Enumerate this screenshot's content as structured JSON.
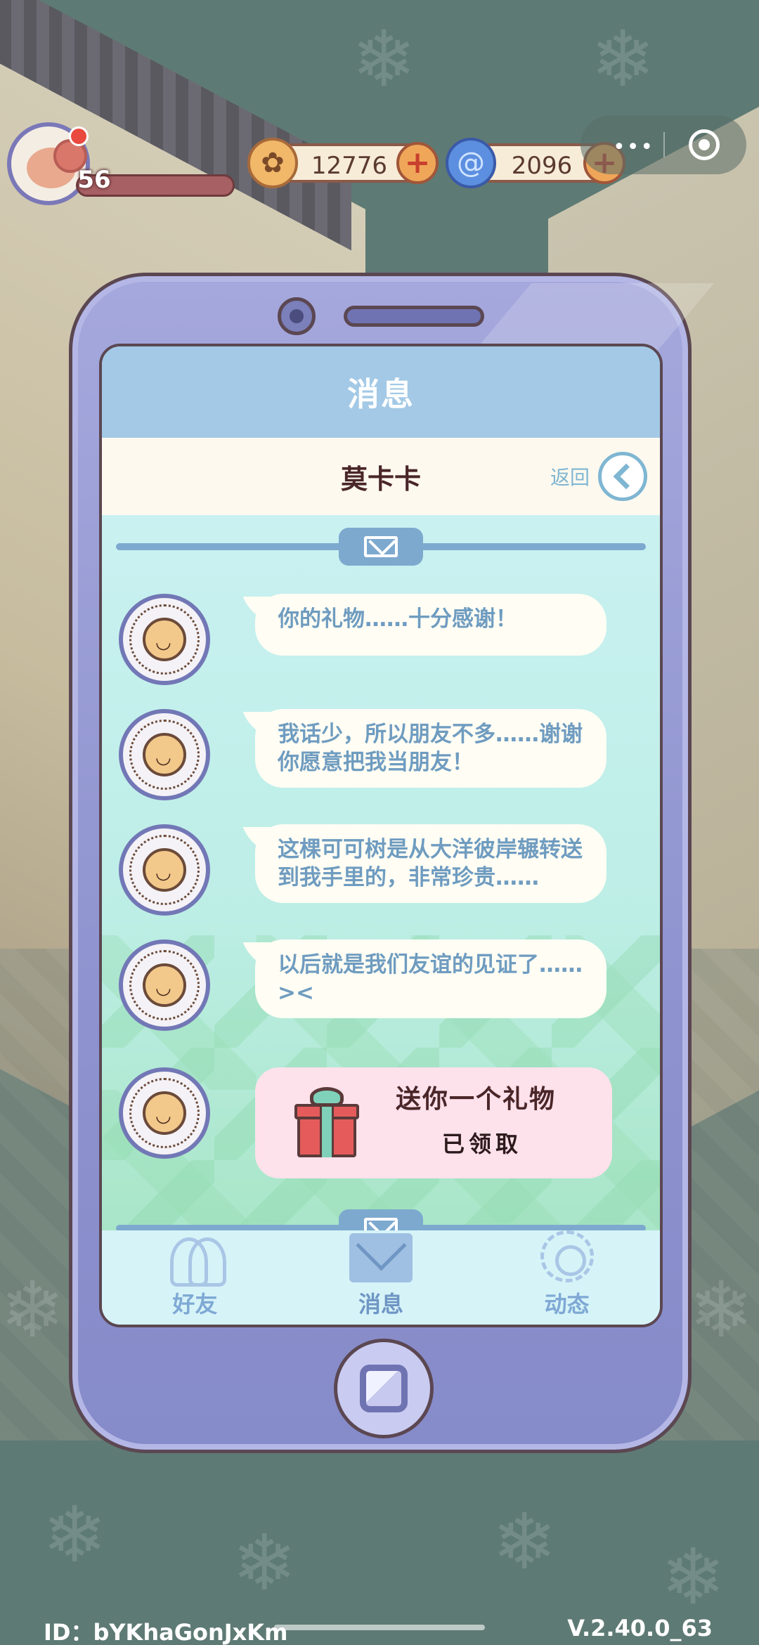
{
  "hud": {
    "level": "56",
    "coins": "12776",
    "gems": "2096",
    "plus_glyph": "+",
    "menu_dots": "•••"
  },
  "phone": {
    "title": "消息",
    "contact_name": "莫卡卡",
    "back_label": "返回"
  },
  "messages": [
    {
      "text": "你的礼物……十分感谢！"
    },
    {
      "text": "我话少，所以朋友不多……谢谢你愿意把我当朋友！"
    },
    {
      "text": "这棵可可树是从大洋彼岸辗转送到我手里的，非常珍贵……"
    },
    {
      "text": "以后就是我们友谊的见证了……><"
    }
  ],
  "gift": {
    "title": "送你一个礼物",
    "status": "已领取"
  },
  "tabs": [
    {
      "label": "好友",
      "icon": "friends-icon"
    },
    {
      "label": "消息",
      "icon": "mail-icon"
    },
    {
      "label": "动态",
      "icon": "moments-icon"
    }
  ],
  "footer": {
    "id": "ID：bYKhaGonJxKm",
    "version": "V.2.40.0_63"
  },
  "colors": {
    "background": "#5e7a74",
    "phone_body": "#8f93cf",
    "screen_header": "#a3c9e6",
    "bubble_text": "#6f9cc0",
    "gift_card": "#fde1eb"
  }
}
